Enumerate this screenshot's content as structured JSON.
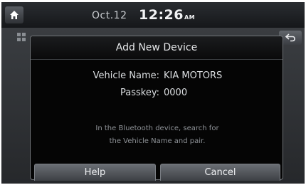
{
  "status_bar": {
    "home_icon": "home-icon",
    "date": "Oct.12",
    "time": "12:26",
    "ampm": "AM"
  },
  "background": {
    "menu_icon": "grid-menu-icon",
    "back_icon": "back-arrow-icon"
  },
  "dialog": {
    "title": "Add New Device",
    "vehicle_name_label": "Vehicle Name:",
    "vehicle_name_value": "KIA MOTORS",
    "passkey_label": "Passkey:",
    "passkey_value": "0000",
    "message_line1": "In the Bluetooth device, search for",
    "message_line2": "the Vehicle Name and pair.",
    "help_label": "Help",
    "cancel_label": "Cancel"
  },
  "colors": {
    "background": "#000000",
    "dialog_border": "#707478",
    "button_top": "#6a6e74",
    "button_bottom": "#3d4045"
  }
}
